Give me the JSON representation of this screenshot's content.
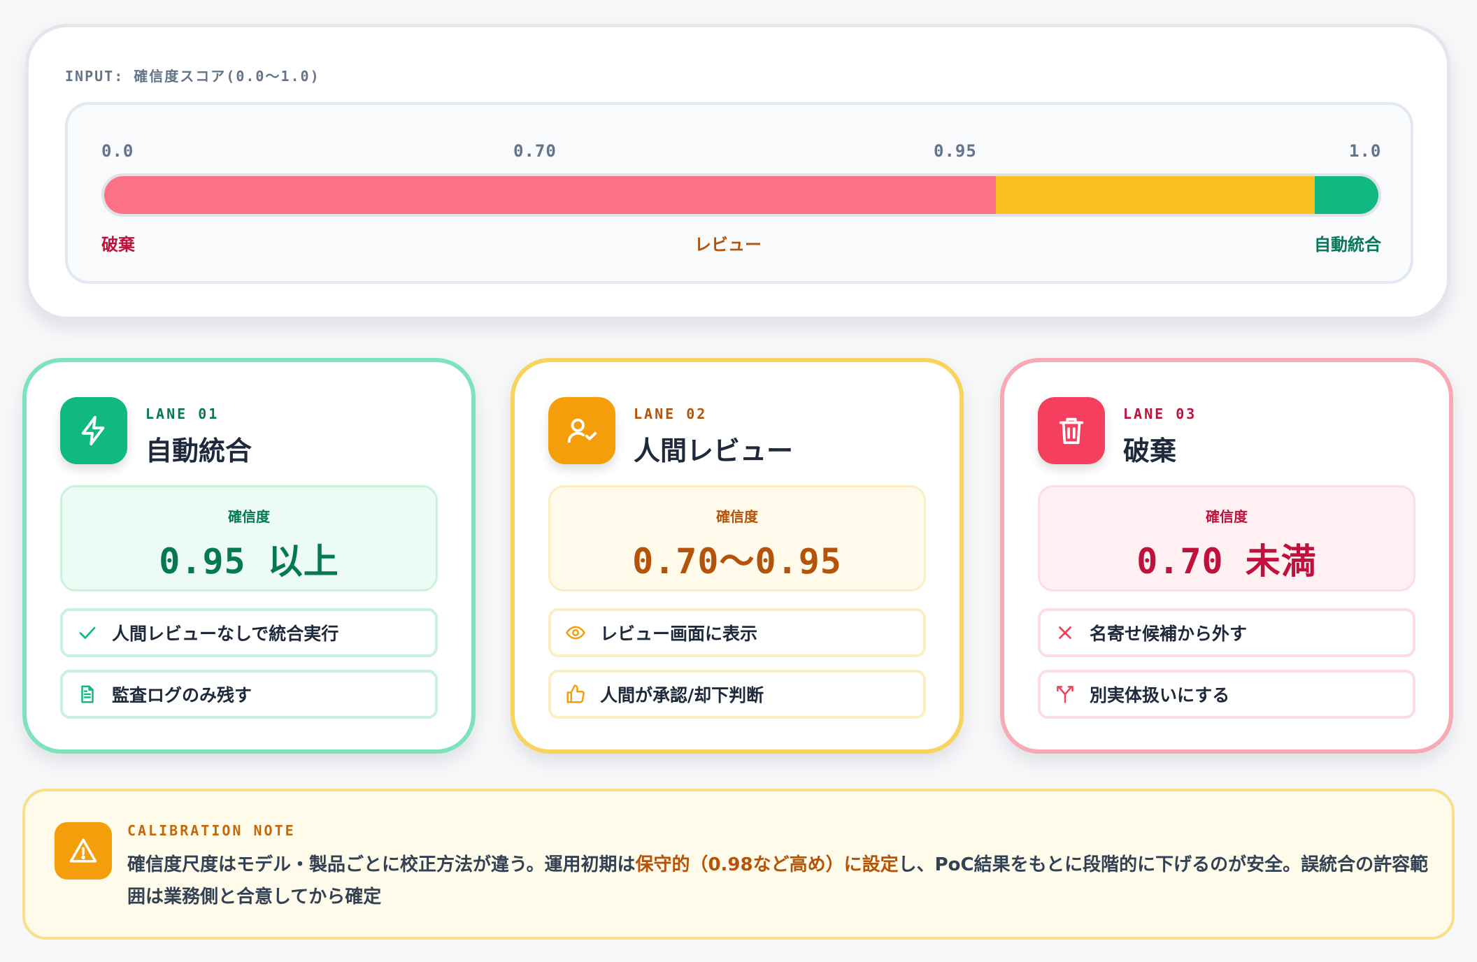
{
  "input": {
    "label": "INPUT: 確信度スコア(0.0〜1.0)",
    "ticks": [
      "0.0",
      "0.70",
      "0.95",
      "1.0"
    ],
    "bands": [
      {
        "name": "破棄",
        "from": 0.0,
        "to": 0.7,
        "color": "#fb7185"
      },
      {
        "name": "レビュー",
        "from": 0.7,
        "to": 0.95,
        "color": "#fbbf24"
      },
      {
        "name": "自動統合",
        "from": 0.95,
        "to": 1.0,
        "color": "#10b981"
      }
    ],
    "zone_labels": {
      "discard": "破棄",
      "review": "レビュー",
      "auto": "自動統合"
    }
  },
  "lanes": [
    {
      "tag": "LANE 01",
      "title": "自動統合",
      "icon": "lightning-icon",
      "conf_label": "確信度",
      "conf_value": "0.95 以上",
      "actions": [
        {
          "icon": "check-icon",
          "text": "人間レビューなしで統合実行"
        },
        {
          "icon": "document-icon",
          "text": "監査ログのみ残す"
        }
      ],
      "colors": {
        "accent": "#10b981",
        "border": "#7ee2bc",
        "text": "#047857",
        "box_bg": "#ecfbf3",
        "box_border": "#c9f2dd"
      }
    },
    {
      "tag": "LANE 02",
      "title": "人間レビュー",
      "icon": "user-check-icon",
      "conf_label": "確信度",
      "conf_value": "0.70〜0.95",
      "actions": [
        {
          "icon": "eye-icon",
          "text": "レビュー画面に表示"
        },
        {
          "icon": "thumbs-up-icon",
          "text": "人間が承認/却下判断"
        }
      ],
      "colors": {
        "accent": "#f59e0b",
        "border": "#f8d45f",
        "text": "#b45309",
        "box_bg": "#fffaea",
        "box_border": "#fbefc2"
      }
    },
    {
      "tag": "LANE 03",
      "title": "破棄",
      "icon": "trash-icon",
      "conf_label": "確信度",
      "conf_value": "0.70 未満",
      "actions": [
        {
          "icon": "x-icon",
          "text": "名寄せ候補から外す"
        },
        {
          "icon": "split-icon",
          "text": "別実体扱いにする"
        }
      ],
      "colors": {
        "accent": "#f43f5e",
        "border": "#f8a9b6",
        "text": "#be123c",
        "box_bg": "#fff1f3",
        "box_border": "#fbdde2"
      }
    }
  ],
  "note": {
    "tag": "CALIBRATION NOTE",
    "text_before": "確信度尺度はモデル・製品ごとに校正方法が違う。運用初期は",
    "text_highlight": "保守的（0.98など高め）に設定",
    "text_after": "し、PoC結果をもとに段階的に下げるのが安全。誤統合の許容範囲は業務側と合意してから確定",
    "icon": "warning-icon"
  }
}
